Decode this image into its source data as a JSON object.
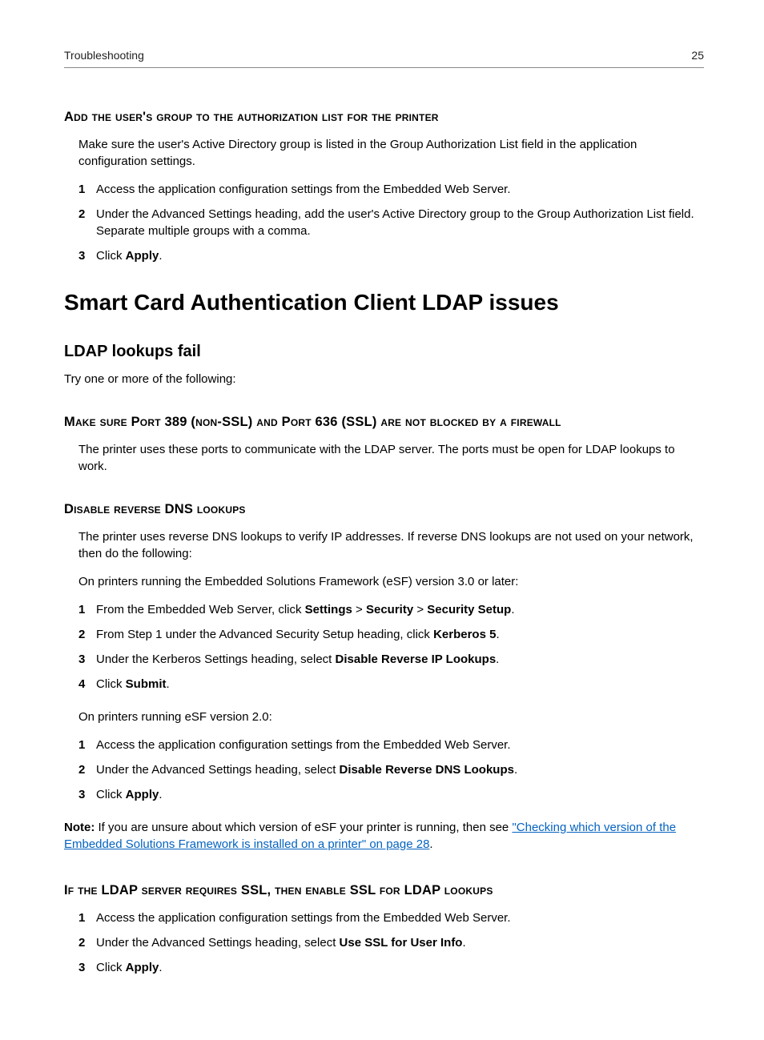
{
  "header": {
    "section": "Troubleshooting",
    "page": "25"
  },
  "sec1": {
    "heading": "Add the user's group to the authorization list for the printer",
    "intro": "Make sure the user's Active Directory group is listed in the Group Authorization List field in the application configuration settings.",
    "steps": [
      "Access the application configuration settings from the Embedded Web Server.",
      "Under the Advanced Settings heading, add the user's Active Directory group to the Group Authorization List field. Separate multiple groups with a comma."
    ],
    "step3_prefix": "Click ",
    "step3_bold": "Apply",
    "step3_suffix": "."
  },
  "main_heading": "Smart Card Authentication Client LDAP issues",
  "sub_heading": "LDAP lookups fail",
  "try_line": "Try one or more of the following:",
  "sec2": {
    "heading": "Make sure Port 389 (non-SSL) and Port 636 (SSL) are not blocked by a firewall",
    "body": "The printer uses these ports to communicate with the LDAP server. The ports must be open for LDAP lookups to work."
  },
  "sec3": {
    "heading": "Disable reverse DNS lookups",
    "intro": "The printer uses reverse DNS lookups to verify IP addresses. If reverse DNS lookups are not used on your network, then do the following:",
    "line_a": "On printers running the Embedded Solutions Framework (eSF) version 3.0 or later:",
    "a1_pre": "From the Embedded Web Server, click ",
    "a1_b1": "Settings",
    "a1_gt1": " > ",
    "a1_b2": "Security",
    "a1_gt2": " > ",
    "a1_b3": "Security Setup",
    "a1_suf": ".",
    "a2_pre": "From Step 1 under the Advanced Security Setup heading, click ",
    "a2_b": "Kerberos 5",
    "a2_suf": ".",
    "a3_pre": "Under the Kerberos Settings heading, select ",
    "a3_b": "Disable Reverse IP Lookups",
    "a3_suf": ".",
    "a4_pre": "Click ",
    "a4_b": "Submit",
    "a4_suf": ".",
    "line_b": "On printers running eSF version 2.0:",
    "b1": "Access the application configuration settings from the Embedded Web Server.",
    "b2_pre": "Under the Advanced Settings heading, select ",
    "b2_b": "Disable Reverse DNS Lookups",
    "b2_suf": ".",
    "b3_pre": "Click ",
    "b3_b": "Apply",
    "b3_suf": "."
  },
  "note": {
    "label": "Note:",
    "pre": " If you are unsure about which version of eSF your printer is running, then see ",
    "link": "\"Checking which version of the Embedded Solutions Framework is installed on a printer\" on page 28",
    "suf": "."
  },
  "sec4": {
    "heading": "If the LDAP server requires SSL, then enable SSL for LDAP lookups",
    "s1": "Access the application configuration settings from the Embedded Web Server.",
    "s2_pre": "Under the Advanced Settings heading, select ",
    "s2_b": "Use SSL for User Info",
    "s2_suf": ".",
    "s3_pre": "Click ",
    "s3_b": "Apply",
    "s3_suf": "."
  }
}
